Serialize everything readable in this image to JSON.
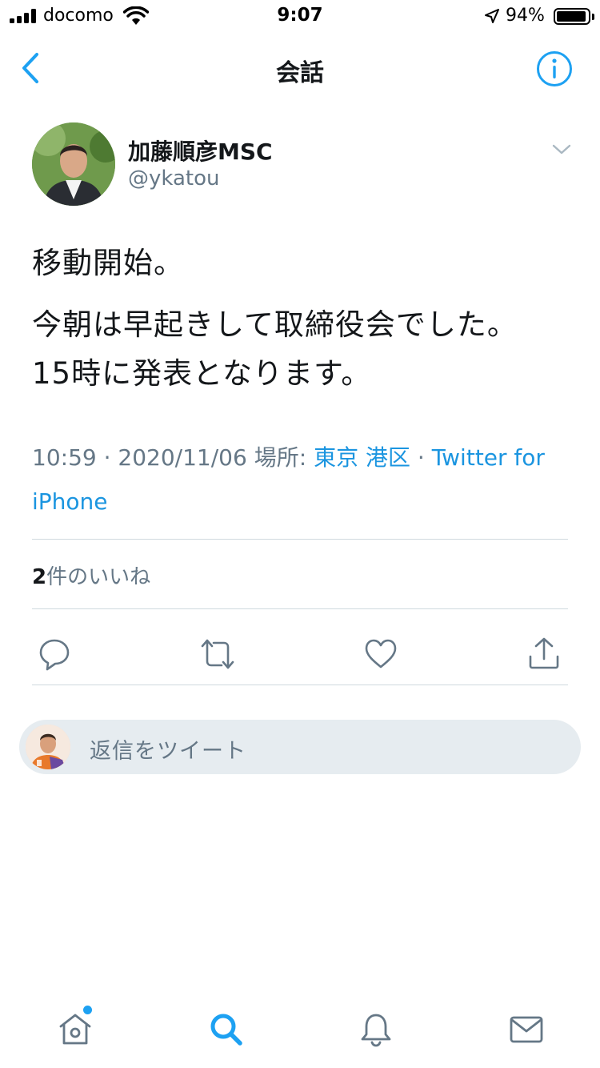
{
  "status_bar": {
    "carrier": "docomo",
    "time": "9:07",
    "battery_percent": "94%",
    "battery_level": 0.94
  },
  "nav": {
    "title": "会話",
    "back_icon": "chevron-left-icon",
    "info_icon": "info-circle-icon"
  },
  "tweet": {
    "author_name": "加藤順彦MSC",
    "author_handle": "@ykatou",
    "text_line1": "移動開始。",
    "text_line2": "今朝は早起きして取締役会でした。",
    "text_line3": "15時に発表となります。",
    "time": "10:59",
    "date": "2020/11/06",
    "location_label": "場所:",
    "location": "東京 港区",
    "source": "Twitter for iPhone",
    "separator": "·",
    "likes_count": "2",
    "likes_label": "件のいいね"
  },
  "reply": {
    "placeholder": "返信をツイート"
  },
  "colors": {
    "accent": "#1da1f2",
    "link": "#1b95e0",
    "secondary_text": "#657786",
    "divider": "#cfd9de",
    "reply_bg": "#e6ecf0"
  },
  "tabs": [
    "home-icon",
    "search-icon",
    "notifications-icon",
    "messages-icon"
  ]
}
